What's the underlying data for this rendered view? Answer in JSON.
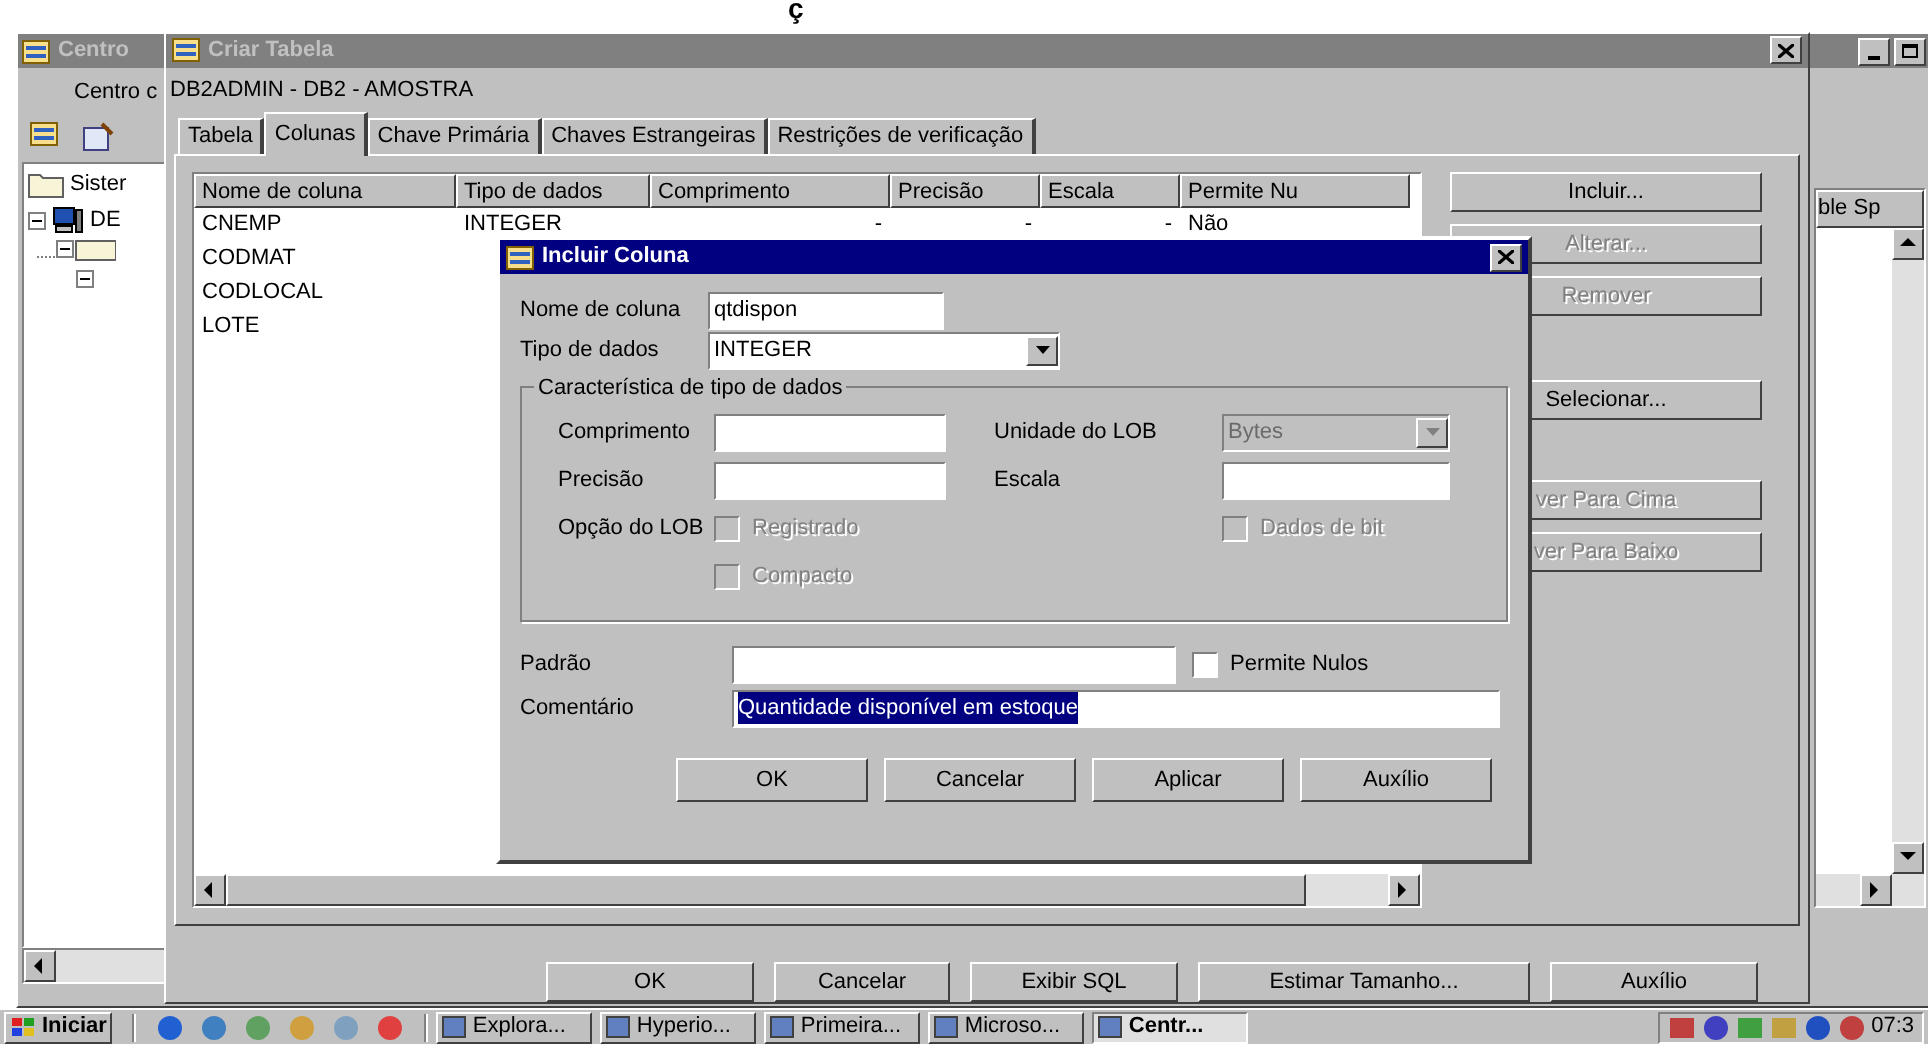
{
  "top_fragment": "ç",
  "main_window": {
    "title": "Centro",
    "subtitle": "Centro c",
    "tree": [
      {
        "label": "Sister",
        "kind": "folder"
      },
      {
        "label": "DE",
        "kind": "computer",
        "expanded": true
      }
    ],
    "side_column": "ble Sp"
  },
  "table_window": {
    "title": "Criar Tabela",
    "subtitle": "DB2ADMIN - DB2 - AMOSTRA",
    "tabs": [
      {
        "label": "Tabela",
        "selected": false
      },
      {
        "label": "Colunas",
        "selected": true
      },
      {
        "label": "Chave Primária",
        "selected": false
      },
      {
        "label": "Chaves Estrangeiras",
        "selected": false
      },
      {
        "label": "Restrições de verificação",
        "selected": false
      }
    ],
    "table": {
      "columns": [
        "Nome de coluna",
        "Tipo de dados",
        "Comprimento",
        "Precisão",
        "Escala",
        "Permite Nu"
      ],
      "rows": [
        [
          "CNEMP",
          "INTEGER",
          "-",
          "-",
          "-",
          "Não"
        ],
        [
          "CODMAT"
        ],
        [
          "CODLOCAL"
        ],
        [
          "LOTE"
        ]
      ]
    },
    "side_buttons": [
      {
        "label": "Incluir...",
        "disabled": false
      },
      {
        "label": "Alterar...",
        "disabled": true
      },
      {
        "label": "Remover",
        "disabled": true
      },
      {
        "label": "Selecionar...",
        "disabled": false
      },
      {
        "label": "ver Para Cima",
        "disabled": true
      },
      {
        "label": "ver Para Baixo",
        "disabled": true
      }
    ],
    "buttons": [
      "OK",
      "Cancelar",
      "Exibir SQL",
      "Estimar Tamanho...",
      "Auxílio"
    ]
  },
  "column_dialog": {
    "title": "Incluir Coluna",
    "column_name": {
      "label": "Nome de coluna",
      "value": "qtdispon"
    },
    "data_type": {
      "label": "Tipo de dados",
      "value": "INTEGER"
    },
    "group": {
      "title": "Característica de tipo de dados",
      "length": {
        "label": "Comprimento"
      },
      "lob_unit": {
        "label": "Unidade do LOB",
        "value": "Bytes",
        "disabled": true
      },
      "precision": {
        "label": "Precisão"
      },
      "scale": {
        "label": "Escala"
      },
      "lob_option": {
        "label": "Opção do LOB"
      },
      "checkboxes": [
        {
          "label": "Registrado",
          "checked": false,
          "disabled": true
        },
        {
          "label": "Dados de bit",
          "checked": false,
          "disabled": true
        },
        {
          "label": "Compacto",
          "checked": false,
          "disabled": true
        }
      ]
    },
    "default": {
      "label": "Padrão"
    },
    "nullable": {
      "label": "Permite Nulos",
      "checked": false,
      "disabled": false
    },
    "comment": {
      "label": "Comentário",
      "value": "Quantidade disponível em estoque",
      "selected": true
    },
    "buttons": [
      "OK",
      "Cancelar",
      "Aplicar",
      "Auxílio"
    ]
  },
  "taskbar": {
    "start": "Iniciar",
    "tasks": [
      {
        "label": "Explora...",
        "selected": false
      },
      {
        "label": "Hyperio...",
        "selected": false
      },
      {
        "label": "Primeira...",
        "selected": false
      },
      {
        "label": "Microso...",
        "selected": false
      },
      {
        "label": "Centr...",
        "selected": true
      }
    ],
    "clock": "07:3"
  }
}
